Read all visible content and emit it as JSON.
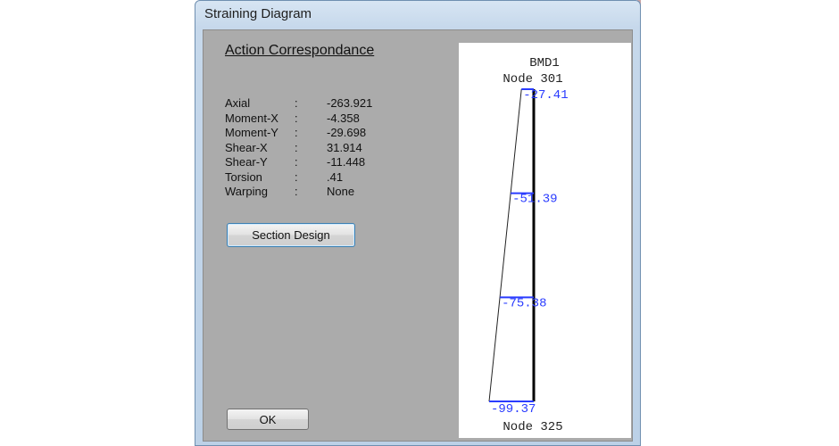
{
  "window": {
    "title": "Straining Diagram"
  },
  "panel": {
    "heading": "Action Correspondance",
    "properties": [
      {
        "name": "Axial",
        "sep": ":",
        "value": "-263.921"
      },
      {
        "name": "Moment-X",
        "sep": ":",
        "value": "-4.358"
      },
      {
        "name": "Moment-Y",
        "sep": ":",
        "value": "-29.698"
      },
      {
        "name": "Shear-X",
        "sep": ":",
        "value": "31.914"
      },
      {
        "name": "Shear-Y",
        "sep": ":",
        "value": "-11.448"
      },
      {
        "name": "Torsion",
        "sep": ":",
        "value": ".41"
      },
      {
        "name": "Warping",
        "sep": ":",
        "value": "None"
      }
    ],
    "section_design_label": "Section Design",
    "ok_label": "OK"
  },
  "diagram": {
    "title": "BMD1",
    "start_node": "Node 301",
    "end_node": "Node 325",
    "label_color": "#2a3cff",
    "stations": [
      {
        "label": "-27.41",
        "value": -27.41
      },
      {
        "label": "-51.39",
        "value": -51.39
      },
      {
        "label": "-75.38",
        "value": -75.38
      },
      {
        "label": "-99.37",
        "value": -99.37
      }
    ]
  }
}
